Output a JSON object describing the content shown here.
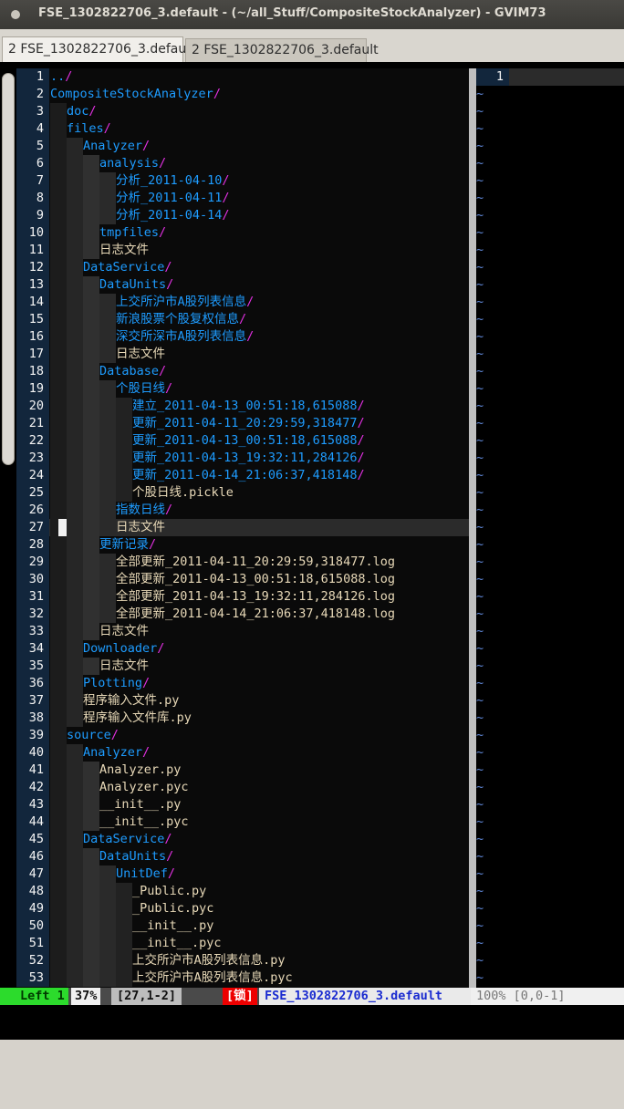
{
  "window": {
    "title": "FSE_1302822706_3.default - (~/all_Stuff/CompositeStockAnalyzer) - GVIM73"
  },
  "tabs": [
    {
      "label": "2 FSE_1302822706_3.default",
      "active": true
    },
    {
      "label": "2 FSE_1302822706_3.default",
      "active": false
    }
  ],
  "editor": {
    "current_line": 27,
    "lines": [
      {
        "n": "1",
        "depth": 0,
        "name": "..",
        "type": "dir"
      },
      {
        "n": "2",
        "depth": 0,
        "name": "CompositeStockAnalyzer",
        "type": "dir"
      },
      {
        "n": "3",
        "depth": 1,
        "name": "doc",
        "type": "dir"
      },
      {
        "n": "4",
        "depth": 1,
        "name": "files",
        "type": "dir"
      },
      {
        "n": "5",
        "depth": 2,
        "name": "Analyzer",
        "type": "dir"
      },
      {
        "n": "6",
        "depth": 3,
        "name": "analysis",
        "type": "dir"
      },
      {
        "n": "7",
        "depth": 4,
        "name": "分析_2011-04-10",
        "type": "dir"
      },
      {
        "n": "8",
        "depth": 4,
        "name": "分析_2011-04-11",
        "type": "dir"
      },
      {
        "n": "9",
        "depth": 4,
        "name": "分析_2011-04-14",
        "type": "dir"
      },
      {
        "n": "10",
        "depth": 3,
        "name": "tmpfiles",
        "type": "dir"
      },
      {
        "n": "11",
        "depth": 3,
        "name": "日志文件",
        "type": "file"
      },
      {
        "n": "12",
        "depth": 2,
        "name": "DataService",
        "type": "dir"
      },
      {
        "n": "13",
        "depth": 3,
        "name": "DataUnits",
        "type": "dir"
      },
      {
        "n": "14",
        "depth": 4,
        "name": "上交所沪市A股列表信息",
        "type": "dir"
      },
      {
        "n": "15",
        "depth": 4,
        "name": "新浪股票个股复权信息",
        "type": "dir"
      },
      {
        "n": "16",
        "depth": 4,
        "name": "深交所深市A股列表信息",
        "type": "dir"
      },
      {
        "n": "17",
        "depth": 4,
        "name": "日志文件",
        "type": "file"
      },
      {
        "n": "18",
        "depth": 3,
        "name": "Database",
        "type": "dir"
      },
      {
        "n": "19",
        "depth": 4,
        "name": "个股日线",
        "type": "dir"
      },
      {
        "n": "20",
        "depth": 5,
        "name": "建立_2011-04-13_00:51:18,615088",
        "type": "dir"
      },
      {
        "n": "21",
        "depth": 5,
        "name": "更新_2011-04-11_20:29:59,318477",
        "type": "dir"
      },
      {
        "n": "22",
        "depth": 5,
        "name": "更新_2011-04-13_00:51:18,615088",
        "type": "dir"
      },
      {
        "n": "23",
        "depth": 5,
        "name": "更新_2011-04-13_19:32:11,284126",
        "type": "dir"
      },
      {
        "n": "24",
        "depth": 5,
        "name": "更新_2011-04-14_21:06:37,418148",
        "type": "dir"
      },
      {
        "n": "25",
        "depth": 5,
        "name": "个股日线.pickle",
        "type": "file"
      },
      {
        "n": "26",
        "depth": 4,
        "name": "指数日线",
        "type": "dir"
      },
      {
        "n": "27",
        "depth": 4,
        "name": "日志文件",
        "type": "file"
      },
      {
        "n": "28",
        "depth": 3,
        "name": "更新记录",
        "type": "dir"
      },
      {
        "n": "29",
        "depth": 4,
        "name": "全部更新_2011-04-11_20:29:59,318477.log",
        "type": "file"
      },
      {
        "n": "30",
        "depth": 4,
        "name": "全部更新_2011-04-13_00:51:18,615088.log",
        "type": "file"
      },
      {
        "n": "31",
        "depth": 4,
        "name": "全部更新_2011-04-13_19:32:11,284126.log",
        "type": "file"
      },
      {
        "n": "32",
        "depth": 4,
        "name": "全部更新_2011-04-14_21:06:37,418148.log",
        "type": "file"
      },
      {
        "n": "33",
        "depth": 3,
        "name": "日志文件",
        "type": "file"
      },
      {
        "n": "34",
        "depth": 2,
        "name": "Downloader",
        "type": "dir"
      },
      {
        "n": "35",
        "depth": 3,
        "name": "日志文件",
        "type": "file"
      },
      {
        "n": "36",
        "depth": 2,
        "name": "Plotting",
        "type": "dir"
      },
      {
        "n": "37",
        "depth": 2,
        "name": "程序输入文件.py",
        "type": "file"
      },
      {
        "n": "38",
        "depth": 2,
        "name": "程序输入文件库.py",
        "type": "file"
      },
      {
        "n": "39",
        "depth": 1,
        "name": "source",
        "type": "dir"
      },
      {
        "n": "40",
        "depth": 2,
        "name": "Analyzer",
        "type": "dir"
      },
      {
        "n": "41",
        "depth": 3,
        "name": "Analyzer.py",
        "type": "file"
      },
      {
        "n": "42",
        "depth": 3,
        "name": "Analyzer.pyc",
        "type": "file"
      },
      {
        "n": "43",
        "depth": 3,
        "name": "__init__.py",
        "type": "file"
      },
      {
        "n": "44",
        "depth": 3,
        "name": "__init__.pyc",
        "type": "file"
      },
      {
        "n": "45",
        "depth": 2,
        "name": "DataService",
        "type": "dir"
      },
      {
        "n": "46",
        "depth": 3,
        "name": "DataUnits",
        "type": "dir"
      },
      {
        "n": "47",
        "depth": 4,
        "name": "UnitDef",
        "type": "dir"
      },
      {
        "n": "48",
        "depth": 5,
        "name": "_Public.py",
        "type": "file"
      },
      {
        "n": "49",
        "depth": 5,
        "name": "_Public.pyc",
        "type": "file"
      },
      {
        "n": "50",
        "depth": 5,
        "name": "__init__.py",
        "type": "file"
      },
      {
        "n": "51",
        "depth": 5,
        "name": "__init__.pyc",
        "type": "file"
      },
      {
        "n": "52",
        "depth": 5,
        "name": "上交所沪市A股列表信息.py",
        "type": "file"
      },
      {
        "n": "53",
        "depth": 5,
        "name": "上交所沪市A股列表信息.pyc",
        "type": "file"
      }
    ]
  },
  "right_window": {
    "first_line": "1",
    "filler": "~",
    "filler_count": 52
  },
  "statusline": {
    "mode": "Left 1",
    "percent": "37%",
    "position": "[27,1-2]",
    "lock": "[锁]",
    "filename": "FSE_1302822706_3.default",
    "right": "100% [0,0-1]"
  },
  "colors": {
    "directory": "#1e9cff",
    "slash": "#e030e0",
    "file": "#e8d9b8",
    "line_number_bg": "#12263c",
    "mode_bg": "#2cdb2c",
    "lock_bg": "#ee0000",
    "filename_fg": "#1a2bd0"
  }
}
